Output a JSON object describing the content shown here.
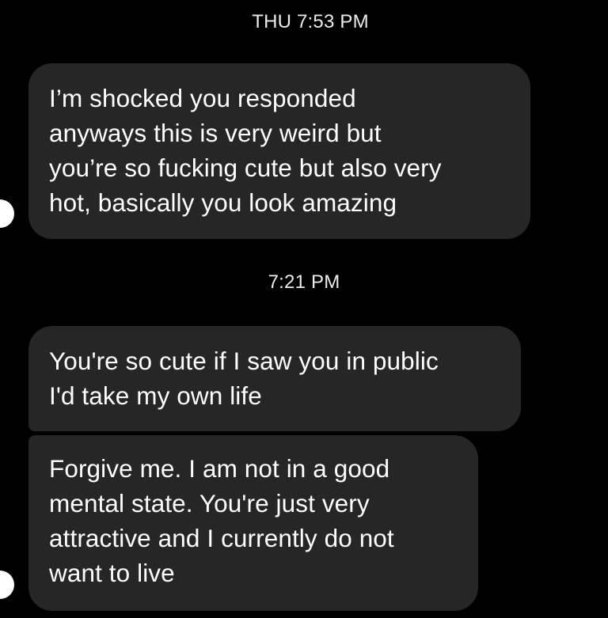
{
  "conversation": {
    "timestamps": [
      {
        "label": "THU 7:53 PM"
      },
      {
        "label": "7:21 PM"
      }
    ],
    "messages": [
      {
        "text": "I’m shocked you responded\nanyways this is very weird but\nyou’re so fucking cute but also very\nhot, basically you look amazing"
      },
      {
        "text": "You're so cute if I saw you in public\nI'd take my own life"
      },
      {
        "text": "Forgive me. I am not in a good\nmental state. You're just very\nattractive and I currently do not\nwant to live"
      }
    ]
  },
  "theme": {
    "background": "#000000",
    "bubble_color": "#262626",
    "text_color": "#ffffff"
  }
}
